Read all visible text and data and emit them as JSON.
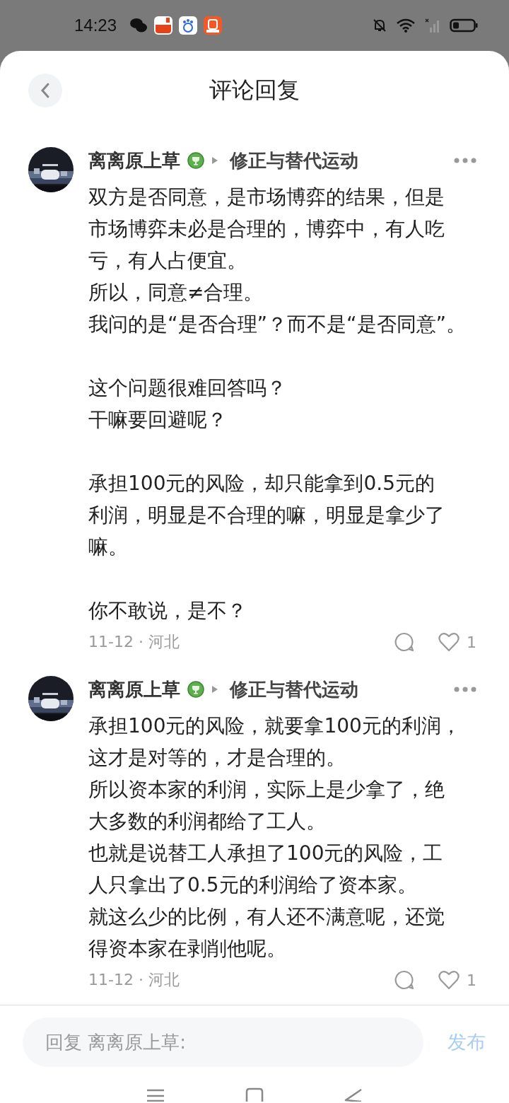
{
  "status_bar": {
    "time": "14:23"
  },
  "header": {
    "title": "评论回复"
  },
  "comments": [
    {
      "author": "离离原上草",
      "topic": "修正与替代运动",
      "paragraphs": [
        [
          "双方是否同意，是市场博弈的结果，但是",
          "市场博弈未必是合理的，博弈中，有人吃",
          "亏，有人占便宜。",
          "所以，同意≠合理。",
          "我问的是“是否合理”？而不是“是否同意”。"
        ],
        [
          "这个问题很难回答吗？",
          "干嘛要回避呢？"
        ],
        [
          "承担100元的风险，却只能拿到0.5元的",
          "利润，明显是不合理的嘛，明显是拿少了",
          "嘛。"
        ],
        [
          "你不敢说，是不？"
        ]
      ],
      "meta": "11-12 · 河北",
      "likes": "1"
    },
    {
      "author": "离离原上草",
      "topic": "修正与替代运动",
      "paragraphs": [
        [
          "承担100元的风险，就要拿100元的利润，",
          "这才是对等的，才是合理的。",
          "所以资本家的利润，实际上是少拿了，绝",
          "大多数的利润都给了工人。",
          "也就是说替工人承担了100元的风险，工",
          "人只拿出了0.5元的利润给了资本家。",
          "就这么少的比例，有人还不满意呢，还觉",
          "得资本家在剥削他呢。"
        ]
      ],
      "meta": "11-12 · 河北",
      "likes": "1"
    }
  ],
  "reply_bar": {
    "placeholder": "回复 离离原上草:",
    "submit": "发布"
  }
}
